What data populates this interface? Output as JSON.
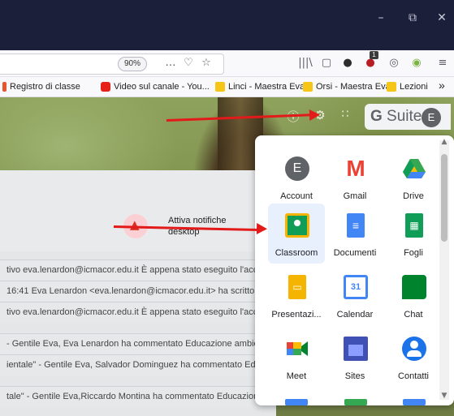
{
  "browser": {
    "window_controls": {
      "minimize": "–",
      "restore": "⧉",
      "close": "✕"
    },
    "zoom": "90%",
    "toolbar_icons": [
      "…",
      "♡",
      "☆"
    ],
    "right_icons": [
      "|||\\",
      "▢",
      "●",
      "●",
      "◎",
      "◉",
      "≡"
    ],
    "bookmarks": [
      {
        "label": "Registro di classe",
        "color": "#e8542c"
      },
      {
        "label": "Video sul canale - You...",
        "color": "#e62117"
      },
      {
        "label": "Linci - Maestra Eva",
        "color": "#f5c518"
      },
      {
        "label": "Orsi - Maestra Eva",
        "color": "#f5c518"
      },
      {
        "label": "Lezioni",
        "color": "#f5c518"
      }
    ],
    "bookmarks_more": "»"
  },
  "gsuite": {
    "label_g": "G",
    "label_rest": " Suite",
    "avatar": "E"
  },
  "notification": {
    "text": "Attiva notifiche desktop"
  },
  "rows": [
    {
      "text": "tivo eva.lenardon@icmacor.edu.it È appena stato eseguito l'acc"
    },
    {
      "text": "16:41 Eva Lenardon <eva.lenardon@icmacor.edu.it> ha scritto: E"
    },
    {
      "text": "tivo eva.lenardon@icmacor.edu.it È appena stato eseguito l'acc"
    },
    {
      "text": " - Gentile Eva, Eva Lenardon ha commentato Educazione ambie"
    },
    {
      "text": "ientale\" - Gentile Eva, Salvador Dominguez ha commentato Educ"
    },
    {
      "text": "tale\" - Gentile Eva,Riccardo Montina ha commentato Educazione"
    }
  ],
  "apps": [
    {
      "label": "Account",
      "color": "#5f6368",
      "glyph": "E"
    },
    {
      "label": "Gmail",
      "color": "#ea4335",
      "glyph": "M"
    },
    {
      "label": "Drive",
      "color": "#0f9d58",
      "glyph": "▲"
    },
    {
      "label": "Classroom",
      "color": "#0f9d58",
      "glyph": "▦"
    },
    {
      "label": "Documenti",
      "color": "#4285f4",
      "glyph": "≡"
    },
    {
      "label": "Fogli",
      "color": "#0f9d58",
      "glyph": "▦"
    },
    {
      "label": "Presentazi...",
      "color": "#f4b400",
      "glyph": "▭"
    },
    {
      "label": "Calendar",
      "color": "#4285f4",
      "glyph": "31"
    },
    {
      "label": "Chat",
      "color": "#00832d",
      "glyph": "◆"
    },
    {
      "label": "Meet",
      "color": "#00897b",
      "glyph": "▶"
    },
    {
      "label": "Sites",
      "color": "#3f51b5",
      "glyph": "▤"
    },
    {
      "label": "Contatti",
      "color": "#1a73e8",
      "glyph": "●"
    }
  ]
}
